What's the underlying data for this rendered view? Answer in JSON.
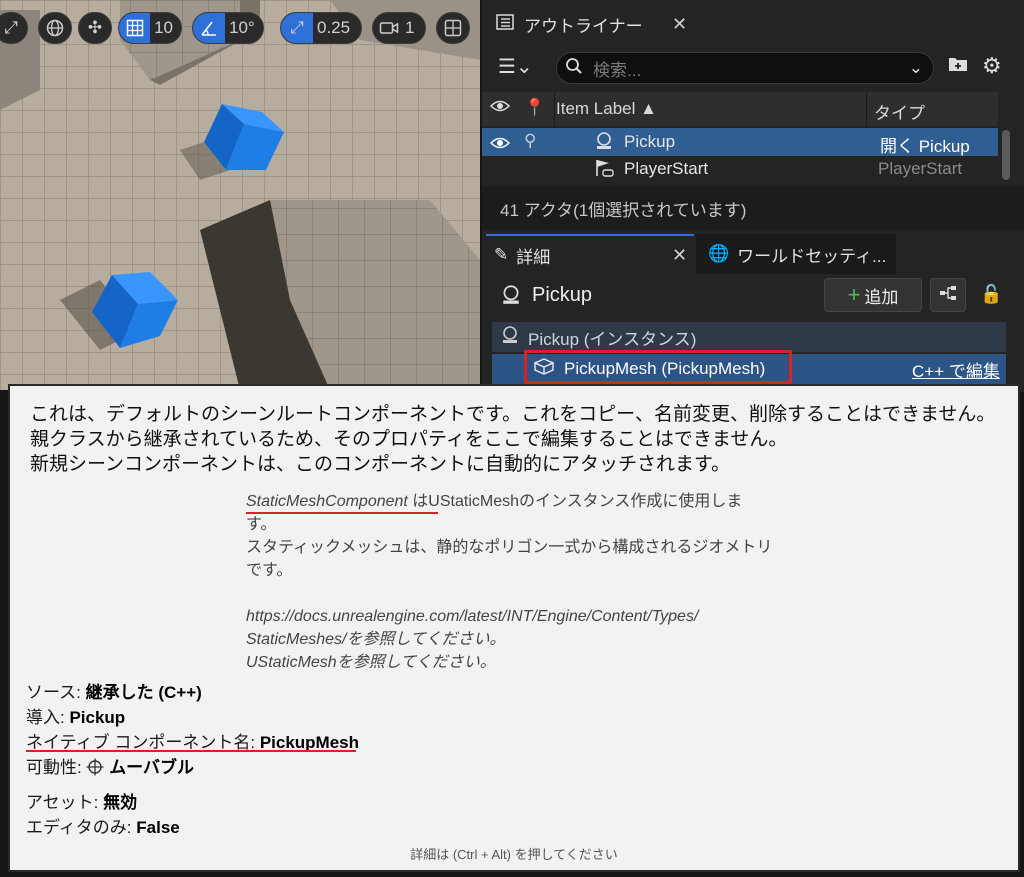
{
  "viewport": {
    "grid_value": "10",
    "angle_value": "10°",
    "scale_value": "0.25",
    "camera_value": "1"
  },
  "outliner": {
    "tab_title": "アウトライナー",
    "search_placeholder": "検索...",
    "col_label": "Item Label ▲",
    "col_type": "タイプ",
    "rows": [
      {
        "label": "Pickup",
        "type": "開く Pickup"
      },
      {
        "label": "PlayerStart",
        "type": "PlayerStart"
      }
    ],
    "status": "41 アクタ(1個選択されています)"
  },
  "details": {
    "tab_title": "詳細",
    "world_tab_title": "ワールドセッティ...",
    "actor_name": "Pickup",
    "add_label": "追加",
    "instance_label": "Pickup (インスタンス)",
    "component_label": "PickupMesh (PickupMesh)",
    "edit_label": "C++ で編集"
  },
  "tooltip": {
    "line1": "これは、デフォルトのシーンルートコンポーネントです。これをコピー、名前変更、削除することはできません。",
    "line2": "親クラスから継承されているため、そのプロパティをここで編集することはできません。",
    "line3": "新規シーンコンポーネントは、このコンポーネントに自動的にアタッチされます。",
    "doc1_link": "StaticMeshComponent",
    "doc1_rest": " はUStaticMeshのインスタンス作成に使用しま",
    "doc2": "す。",
    "doc3": "スタティックメッシュは、静的なポリゴン一式から構成されるジオメトリ",
    "doc4": "です。",
    "doc5": "https://docs.unrealengine.com/latest/INT/Engine/Content/Types/",
    "doc6": "StaticMeshes/を参照してください。",
    "doc7": "UStaticMeshを参照してください。",
    "source_key": "ソース: ",
    "source_val": "継承した (C++)",
    "intro_key": "導入: ",
    "intro_val": "Pickup",
    "native_key": "ネイティブ コンポーネント名: ",
    "native_val": "PickupMesh",
    "mobility_key": "可動性: ",
    "mobility_val": "ムーバブル",
    "asset_key": "アセット: ",
    "asset_val": "無効",
    "editor_key": "エディタのみ: ",
    "editor_val": "False",
    "hint": "詳細は (Ctrl + Alt) を押してください"
  },
  "colors": {
    "accent": "#2f6fd8",
    "selection": "#2f5e93",
    "highlight_box": "#d42424",
    "cube": "#1f7ee6"
  }
}
